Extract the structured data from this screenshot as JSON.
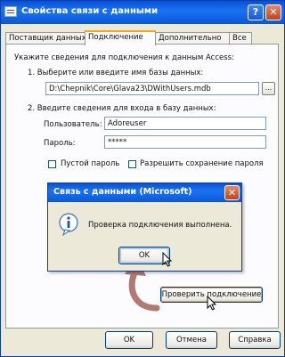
{
  "window": {
    "title": "Свойства связи с данными",
    "help_label": "?",
    "close_label": "✕"
  },
  "tabs": [
    {
      "label": "Поставщик данных"
    },
    {
      "label": "Подключение"
    },
    {
      "label": "Дополнительно"
    },
    {
      "label": "Все"
    }
  ],
  "connection": {
    "instruction": "Укажите сведения для подключения к данным Access:",
    "step1_label": "1. Выберите или введите имя базы данных:",
    "db_path": "D:\\Chepnik\\Core\\Glava23\\DWithUsers.mdb",
    "browse_label": "...",
    "step2_label": "2. Введите сведения для входа в базу данных:",
    "user_label": "Пользователь:",
    "user_value": "Adoreuser",
    "password_label": "Пароль:",
    "password_value": "*****",
    "blank_password_label": "Пустой пароль",
    "allow_save_label": "Разрешить сохранение пароля",
    "test_button_label": "Проверить подключение"
  },
  "footer": {
    "ok_label": "OK",
    "cancel_label": "Отмена",
    "help_label": "Справка"
  },
  "message_box": {
    "title": "Связь с данными (Microsoft)",
    "close_label": "✕",
    "text": "Проверка подключения выполнена.",
    "ok_label": "OK"
  },
  "colors": {
    "titlebar": "#0a57d8",
    "close_button": "#c0421c",
    "active_tab_accent": "#f6a421",
    "decorative_arrow": "#b07a70"
  },
  "icons": {
    "title_icon": "data-link-icon",
    "message_icon": "info-icon",
    "cursor": "mouse-pointer-icon",
    "annotation": "curved-arrow-icon"
  }
}
